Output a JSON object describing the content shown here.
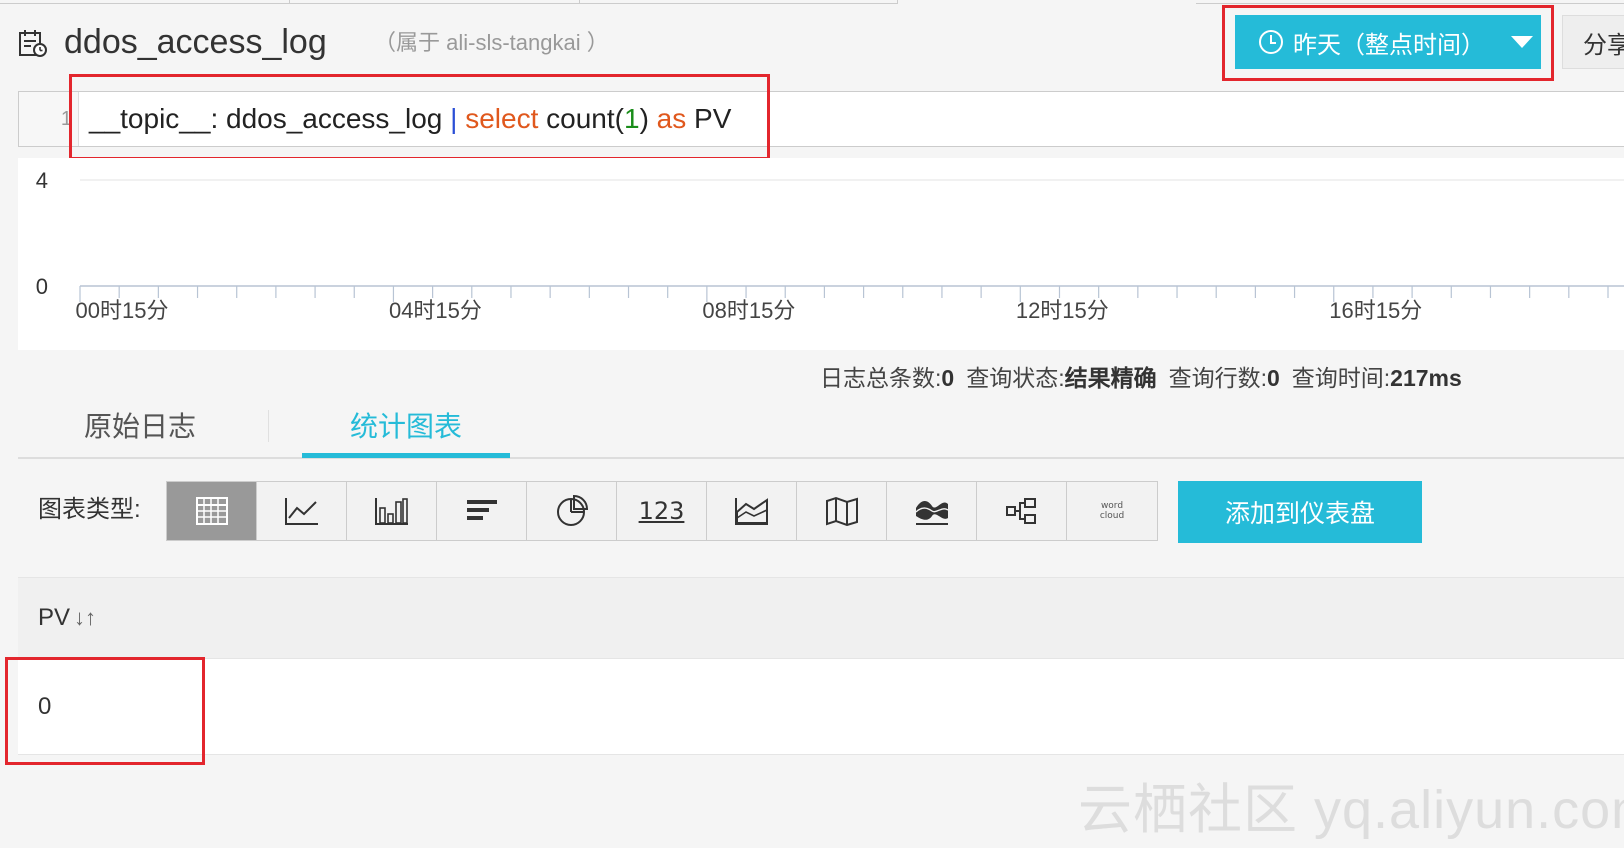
{
  "header": {
    "logstore_name": "ddos_access_log",
    "project_label": "（属于 ali-sls-tangkai ）",
    "time_range_button": "昨天（整点时间）",
    "share_button": "分享"
  },
  "query": {
    "line_number": "1",
    "tokens": {
      "field": "__topic__",
      "colon": ": ",
      "value": "ddos_access_log",
      "pipe": "|",
      "select": "select",
      "func": "count(",
      "num": "1",
      "close": ")",
      "as": "as",
      "alias": "PV"
    }
  },
  "chart_data": {
    "type": "bar",
    "title": "",
    "xlabel": "",
    "ylabel": "",
    "ylim": [
      0,
      4
    ],
    "y_ticks": [
      "4",
      "0"
    ],
    "x_tick_labels": [
      "00时15分",
      "04时15分",
      "08时15分",
      "12时15分",
      "16时15分"
    ],
    "categories": [],
    "values": [],
    "grid": true
  },
  "stats": {
    "total_label": "日志总条数:",
    "total_value": "0",
    "status_label": "查询状态:",
    "status_value": "结果精确",
    "rows_label": "查询行数:",
    "rows_value": "0",
    "time_label": "查询时间:",
    "time_value": "217ms"
  },
  "tabs": {
    "raw": "原始日志",
    "stats": "统计图表",
    "active": "stats"
  },
  "chart_types": {
    "label": "图表类型:",
    "items": [
      "table-icon",
      "line-chart-icon",
      "bar-chart-icon",
      "horizontal-bar-icon",
      "pie-chart-icon",
      "number-icon",
      "area-chart-icon",
      "map-icon",
      "flow-chart-icon",
      "sankey-icon",
      "word-cloud-icon"
    ],
    "number_glyph": "123",
    "wordcloud_glyph_line1": "word",
    "wordcloud_glyph_line2": "cloud",
    "active": "table-icon"
  },
  "add_dashboard_button": "添加到仪表盘",
  "result_table": {
    "columns": [
      "PV"
    ],
    "sort_glyph": "↓↑",
    "rows": [
      [
        "0"
      ]
    ]
  },
  "watermark": "云栖社区 yq.aliyun.com",
  "colors": {
    "accent": "#25bbd8",
    "annotation_red": "#e3262d",
    "keyword_orange": "#e0581d",
    "number_green": "#1a8d1a",
    "pipe_blue": "#2b4fd6"
  }
}
